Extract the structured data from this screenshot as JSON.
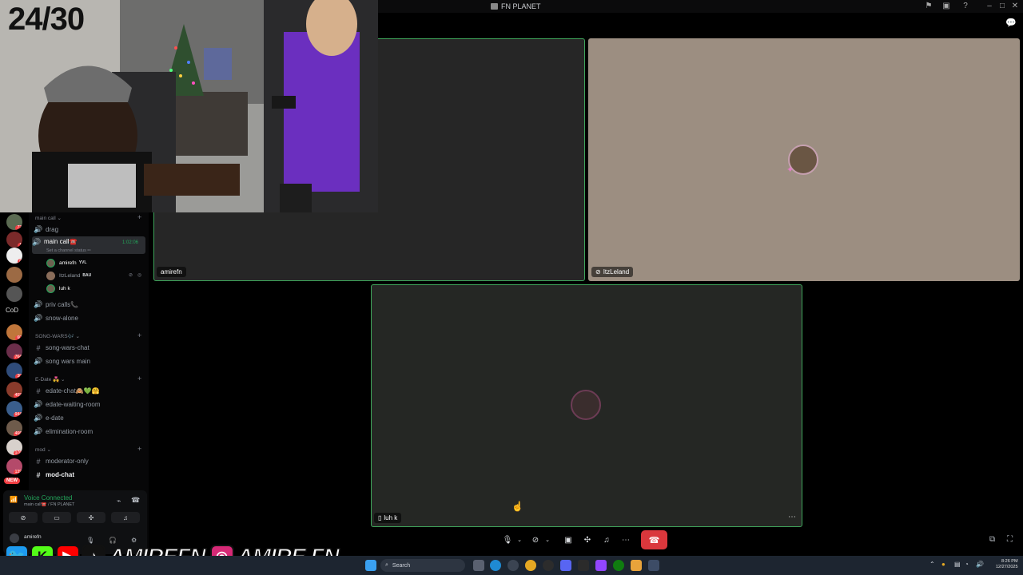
{
  "window": {
    "title": "FN PLANET"
  },
  "overlay": {
    "counter": "24/30",
    "social": {
      "name1": "AMIREFN",
      "name2": "AMIRE.FN"
    }
  },
  "servers": {
    "badges": [
      "72",
      "1",
      "8",
      "60",
      "764",
      "30",
      "409",
      "944",
      "466",
      "176",
      "139"
    ],
    "cod_label": "CoD",
    "new_label": "NEW"
  },
  "sidebar": {
    "categories": [
      {
        "label": "main call"
      },
      {
        "label": "SONG-WARS🎶"
      },
      {
        "label": "E-Date 💑"
      },
      {
        "label": "mod"
      }
    ],
    "channels": [
      {
        "label": "drag"
      },
      {
        "label": "main call☎️"
      },
      {
        "label": "priv calls📞"
      },
      {
        "label": "snow-alone"
      },
      {
        "label": "song-wars-chat"
      },
      {
        "label": "song wars main"
      },
      {
        "label": "edate-chat🙈💚🤗"
      },
      {
        "label": "edate-waiting-room"
      },
      {
        "label": "e-date"
      },
      {
        "label": "elimination-room"
      },
      {
        "label": "moderator-only"
      },
      {
        "label": "mod-chat"
      }
    ],
    "active_timer": "1:02:06",
    "channel_status": "Set a channel status ✏",
    "voice_users": [
      {
        "name": "amirefn",
        "tag": "YVL"
      },
      {
        "name": "ItzLeland",
        "tag": "BAU"
      },
      {
        "name": "luh k",
        "tag": ""
      }
    ]
  },
  "voice_panel": {
    "title": "Voice Connected",
    "subtitle": "main call☎️ / FN PLANET",
    "user": "amirefn"
  },
  "call": {
    "tiles": [
      {
        "name": "amirefn"
      },
      {
        "name": "ItzLeland"
      },
      {
        "name": "luh k"
      }
    ]
  },
  "taskbar": {
    "search_placeholder": "Search",
    "time": "8:26 PM",
    "date": "12/27/2025"
  },
  "colors": {
    "accent_green": "#23a55a",
    "hangup_red": "#da373c",
    "tile_border": "#3fa55b"
  }
}
